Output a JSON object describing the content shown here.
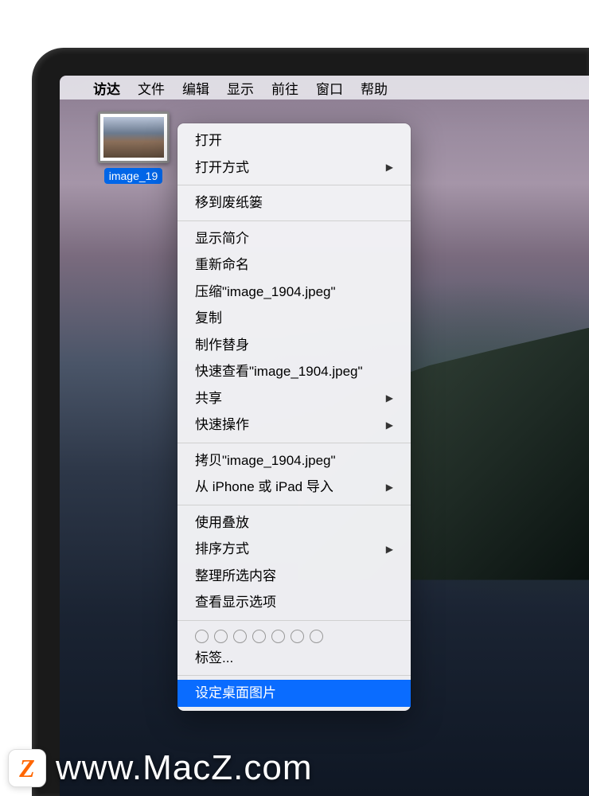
{
  "menubar": {
    "app": "访达",
    "items": [
      "文件",
      "编辑",
      "显示",
      "前往",
      "窗口",
      "帮助"
    ]
  },
  "desktop_icon": {
    "label": "image_19"
  },
  "context_menu": {
    "groups": [
      [
        {
          "label": "打开",
          "submenu": false
        },
        {
          "label": "打开方式",
          "submenu": true
        }
      ],
      [
        {
          "label": "移到废纸篓",
          "submenu": false
        }
      ],
      [
        {
          "label": "显示简介",
          "submenu": false
        },
        {
          "label": "重新命名",
          "submenu": false
        },
        {
          "label": "压缩\"image_1904.jpeg\"",
          "submenu": false
        },
        {
          "label": "复制",
          "submenu": false
        },
        {
          "label": "制作替身",
          "submenu": false
        },
        {
          "label": "快速查看\"image_1904.jpeg\"",
          "submenu": false
        },
        {
          "label": "共享",
          "submenu": true
        },
        {
          "label": "快速操作",
          "submenu": true
        }
      ],
      [
        {
          "label": "拷贝\"image_1904.jpeg\"",
          "submenu": false
        },
        {
          "label": "从 iPhone 或 iPad 导入",
          "submenu": true
        }
      ],
      [
        {
          "label": "使用叠放",
          "submenu": false
        },
        {
          "label": "排序方式",
          "submenu": true
        },
        {
          "label": "整理所选内容",
          "submenu": false
        },
        {
          "label": "查看显示选项",
          "submenu": false
        }
      ]
    ],
    "tags_label": "标签...",
    "selected_item": "设定桌面图片"
  },
  "watermark": {
    "badge": "Z",
    "text": "www.MacZ.com"
  }
}
